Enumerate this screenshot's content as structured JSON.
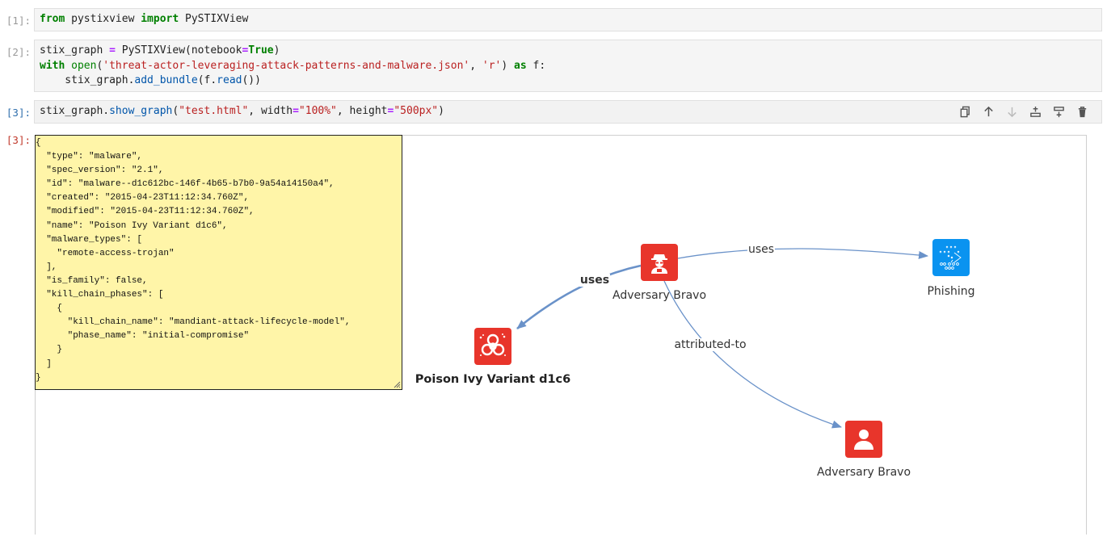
{
  "cells": [
    {
      "prompt": "[1]:",
      "code": "from pystixview import PySTIXView"
    },
    {
      "prompt": "[2]:",
      "code_lines": [
        "stix_graph = PySTIXView(notebook=True)",
        "with open('threat-actor-leveraging-attack-patterns-and-malware.json', 'r') as f:",
        "    stix_graph.add_bundle(f.read())"
      ]
    },
    {
      "prompt": "[3]:",
      "code": "stix_graph.show_graph(\"test.html\", width=\"100%\", height=\"500px\")"
    },
    {
      "prompt": "[3]:"
    }
  ],
  "toolbar": [
    "copy-icon",
    "arrow-up-icon",
    "arrow-down-icon",
    "insert-above-icon",
    "insert-below-icon",
    "trash-icon"
  ],
  "tooltip_lines": [
    "{",
    "  \"type\": \"malware\",",
    "  \"spec_version\": \"2.1\",",
    "  \"id\": \"malware--d1c612bc-146f-4b65-b7b0-9a54a14150a4\",",
    "  \"created\": \"2015-04-23T11:12:34.760Z\",",
    "  \"modified\": \"2015-04-23T11:12:34.760Z\",",
    "  \"name\": \"Poison Ivy Variant d1c6\",",
    "  \"malware_types\": [",
    "    \"remote-access-trojan\"",
    "  ],",
    "  \"is_family\": false,",
    "  \"kill_chain_phases\": [",
    "    {",
    "      \"kill_chain_name\": \"mandiant-attack-lifecycle-model\",",
    "      \"phase_name\": \"initial-compromise\"",
    "    }",
    "  ]",
    "}"
  ],
  "graph": {
    "nodes": [
      {
        "label": "Adversary Bravo",
        "kind": "threat-actor-icon",
        "color": "#e8352b"
      },
      {
        "label": "Phishing",
        "kind": "attack-pattern-icon",
        "color": "#0a93f0"
      },
      {
        "label": "Poison Ivy Variant d1c6",
        "kind": "biohazard-icon",
        "color": "#e8352b"
      },
      {
        "label": "Adversary Bravo",
        "kind": "identity-icon",
        "color": "#e8352b"
      }
    ],
    "edges": [
      {
        "label": "uses"
      },
      {
        "label": "uses"
      },
      {
        "label": "attributed-to"
      }
    ],
    "edge_color": "#6a92c9"
  }
}
